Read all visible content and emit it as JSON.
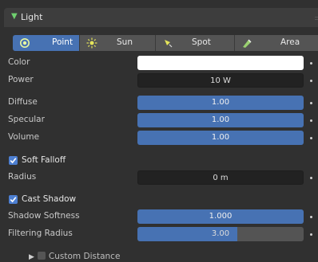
{
  "panel": {
    "title": "Light"
  },
  "light_types": [
    {
      "label": "Point",
      "icon": "point-light-icon",
      "active": true
    },
    {
      "label": "Sun",
      "icon": "sun-icon",
      "active": false
    },
    {
      "label": "Spot",
      "icon": "spot-light-icon",
      "active": false
    },
    {
      "label": "Area",
      "icon": "area-light-icon",
      "active": false
    }
  ],
  "properties": {
    "color_label": "Color",
    "color_value": "#ffffff",
    "power_label": "Power",
    "power_value": "10 W",
    "diffuse_label": "Diffuse",
    "diffuse_value": "1.00",
    "specular_label": "Specular",
    "specular_value": "1.00",
    "volume_label": "Volume",
    "volume_value": "1.00",
    "soft_falloff_label": "Soft Falloff",
    "soft_falloff_checked": true,
    "radius_label": "Radius",
    "radius_value": "0 m",
    "cast_shadow_label": "Cast Shadow",
    "cast_shadow_checked": true,
    "shadow_softness_label": "Shadow Softness",
    "shadow_softness_value": "1.000",
    "filtering_radius_label": "Filtering Radius",
    "filtering_radius_value": "3.00",
    "filtering_radius_fill_fraction": 0.6
  },
  "custom_distance": {
    "label": "Custom Distance",
    "checked": false,
    "expanded": false
  },
  "colors": {
    "accent": "#4772b3",
    "panel": "#303030",
    "field_dark": "#222222"
  }
}
